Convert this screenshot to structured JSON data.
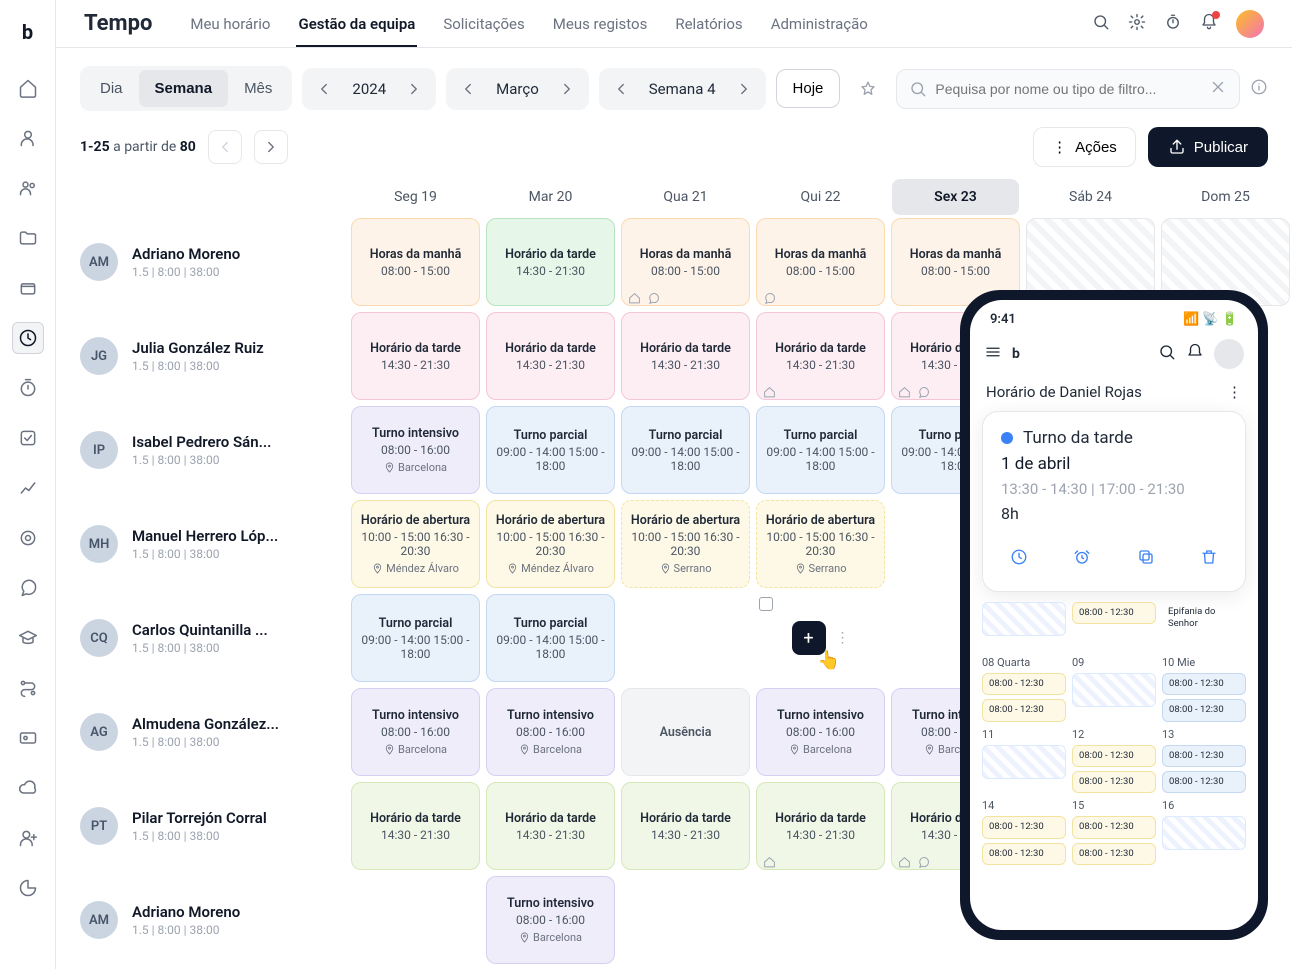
{
  "app_title": "Tempo",
  "tabs": [
    "Meu horário",
    "Gestão da equipa",
    "Solicitações",
    "Meus registos",
    "Relatórios",
    "Administração"
  ],
  "active_tab": 1,
  "view_seg": {
    "options": [
      "Dia",
      "Semana",
      "Mês"
    ],
    "selected": 1
  },
  "year": "2024",
  "month": "Março",
  "week": "Semana 4",
  "today_label": "Hoje",
  "search_placeholder": "Pequisa por nome ou tipo de filtro...",
  "pager": {
    "range": "1-25",
    "sep": "a partir de",
    "total": "80"
  },
  "actions_label": "Ações",
  "publish_label": "Publicar",
  "day_headers": [
    "Seg 19",
    "Mar 20",
    "Qua 21",
    "Qui 22",
    "Sex 23",
    "Sáb 24",
    "Dom 25"
  ],
  "highlight_day": 4,
  "employee_sub": "1.5 | 8:00 | 38:00",
  "employees": [
    {
      "name": "Adriano Moreno",
      "initials": "AM",
      "cells": [
        {
          "type": "orange",
          "title": "Horas da manhã",
          "time": "08:00 - 15:00"
        },
        {
          "type": "green",
          "title": "Horário da tarde",
          "time": "14:30 - 21:30"
        },
        {
          "type": "orange",
          "title": "Horas da manhã",
          "time": "08:00 - 15:00",
          "icons": [
            "home",
            "chat"
          ]
        },
        {
          "type": "orange",
          "title": "Horas da manhã",
          "time": "08:00 - 15:00",
          "icons": [
            "chat"
          ]
        },
        {
          "type": "orange",
          "title": "Horas da manhã",
          "time": "08:00 - 15:00"
        },
        {
          "type": "hatch"
        },
        {
          "type": "hatch"
        }
      ]
    },
    {
      "name": "Julia González Ruiz",
      "initials": "JG",
      "cells": [
        {
          "type": "pink",
          "title": "Horário da tarde",
          "time": "14:30 - 21:30"
        },
        {
          "type": "pink",
          "title": "Horário da tarde",
          "time": "14:30 - 21:30"
        },
        {
          "type": "pink",
          "title": "Horário da tarde",
          "time": "14:30 - 21:30"
        },
        {
          "type": "pink",
          "title": "Horário da tarde",
          "time": "14:30 - 21:30",
          "icons": [
            "home"
          ]
        },
        {
          "type": "pink",
          "title": "Horário da tarde",
          "time": "14:30 - 21:30",
          "icons": [
            "home",
            "chat"
          ]
        },
        {
          "type": "empty"
        },
        {
          "type": "empty"
        }
      ]
    },
    {
      "name": "Isabel Pedrero Sán...",
      "initials": "IP",
      "cells": [
        {
          "type": "purple",
          "title": "Turno intensivo",
          "time": "08:00 - 16:00",
          "loc": "Barcelona"
        },
        {
          "type": "blue",
          "title": "Turno parcial",
          "time": "09:00 - 14:00 15:00 - 18:00"
        },
        {
          "type": "blue",
          "title": "Turno parcial",
          "time": "09:00 - 14:00 15:00 - 18:00"
        },
        {
          "type": "blue",
          "title": "Turno parcial",
          "time": "09:00 - 14:00 15:00 - 18:00"
        },
        {
          "type": "blue",
          "title": "Turno parcial",
          "time": "09:00 - 14:00 15:00 - 18:00"
        },
        {
          "type": "empty"
        },
        {
          "type": "empty"
        }
      ]
    },
    {
      "name": "Manuel Herrero Lóp...",
      "initials": "MH",
      "cells": [
        {
          "type": "yellow",
          "title": "Horário de abertura",
          "time": "10:00 - 15:00 16:30 - 20:30",
          "loc": "Méndez Álvaro"
        },
        {
          "type": "yellow",
          "title": "Horário de abertura",
          "time": "10:00 - 15:00 16:30 - 20:30",
          "loc": "Méndez Álvaro"
        },
        {
          "type": "yellow",
          "dash": true,
          "title": "Horário de abertura",
          "time": "10:00 - 15:00 16:30 - 20:30",
          "loc": "Serrano"
        },
        {
          "type": "yellow",
          "dash": true,
          "title": "Horário de abertura",
          "time": "10:00 - 15:00 16:30 - 20:30",
          "loc": "Serrano"
        },
        {
          "type": "empty"
        },
        {
          "type": "empty"
        },
        {
          "type": "empty"
        }
      ]
    },
    {
      "name": "Carlos Quintanilla ...",
      "initials": "CQ",
      "cells": [
        {
          "type": "blue",
          "title": "Turno parcial",
          "time": "09:00 - 14:00 15:00 - 18:00"
        },
        {
          "type": "blue",
          "title": "Turno parcial",
          "time": "09:00 - 14:00 15:00 - 18:00"
        },
        {
          "type": "empty"
        },
        {
          "type": "hover"
        },
        {
          "type": "empty"
        },
        {
          "type": "empty"
        },
        {
          "type": "empty"
        }
      ]
    },
    {
      "name": "Almudena González...",
      "initials": "AG",
      "cells": [
        {
          "type": "purple",
          "title": "Turno intensivo",
          "time": "08:00 - 16:00",
          "loc": "Barcelona"
        },
        {
          "type": "purple",
          "title": "Turno intensivo",
          "time": "08:00 - 16:00",
          "loc": "Barcelona"
        },
        {
          "type": "grey",
          "title": "Ausência"
        },
        {
          "type": "purple",
          "title": "Turno intensivo",
          "time": "08:00 - 16:00",
          "loc": "Barcelona"
        },
        {
          "type": "purple",
          "title": "Turno intensivo",
          "time": "08:00 - 16:00",
          "loc": "Barcelona"
        },
        {
          "type": "empty"
        },
        {
          "type": "empty"
        }
      ]
    },
    {
      "name": "Pilar Torrejón Corral",
      "initials": "PT",
      "cells": [
        {
          "type": "lgreen",
          "title": "Horário da tarde",
          "time": "14:30 - 21:30"
        },
        {
          "type": "lgreen",
          "title": "Horário da tarde",
          "time": "14:30 - 21:30"
        },
        {
          "type": "lgreen",
          "title": "Horário da tarde",
          "time": "14:30 - 21:30"
        },
        {
          "type": "lgreen",
          "title": "Horário da tarde",
          "time": "14:30 - 21:30",
          "icons": [
            "home"
          ]
        },
        {
          "type": "lgreen",
          "title": "Horário da tarde",
          "time": "14:30 - 21:30",
          "icons": [
            "home",
            "chat"
          ]
        },
        {
          "type": "empty"
        },
        {
          "type": "empty"
        }
      ]
    },
    {
      "name": "Adriano Moreno",
      "initials": "AM",
      "cells": [
        {
          "type": "empty"
        },
        {
          "type": "purple",
          "title": "Turno intensivo",
          "time": "08:00 - 16:00",
          "loc": "Barcelona"
        },
        {
          "type": "empty"
        },
        {
          "type": "empty"
        },
        {
          "type": "empty"
        },
        {
          "type": "empty"
        },
        {
          "type": "empty"
        }
      ]
    }
  ],
  "phone": {
    "time": "9:41",
    "title": "Horário de Daniel Rojas",
    "card": {
      "shift_name": "Turno da tarde",
      "date": "1 de abril",
      "time": "13:30 - 14:30 | 17:00 - 21:30",
      "hours": "8h"
    },
    "cal_top": [
      {
        "label": "",
        "chips": [
          {
            "t": "hatch"
          }
        ]
      },
      {
        "label": "",
        "chips": [
          {
            "t": "yel",
            "text": "08:00 - 12:30"
          }
        ]
      },
      {
        "label": "",
        "chips": [
          {
            "t": "plain",
            "text": "Epifania do Senhor"
          }
        ]
      }
    ],
    "cal": [
      {
        "label": "08 Quarta",
        "chips": [
          {
            "t": "yel",
            "text": "08:00 - 12:30"
          },
          {
            "t": "yel",
            "text": "08:00 - 12:30"
          }
        ]
      },
      {
        "label": "09",
        "chips": [
          {
            "t": "hatch"
          }
        ]
      },
      {
        "label": "10 Mie",
        "chips": [
          {
            "t": "blu",
            "text": "08:00 - 12:30"
          },
          {
            "t": "blu",
            "text": "08:00 - 12:30"
          }
        ]
      },
      {
        "label": "11",
        "chips": [
          {
            "t": "hatch"
          }
        ]
      },
      {
        "label": "12",
        "chips": [
          {
            "t": "yel",
            "text": "08:00 - 12:30"
          },
          {
            "t": "yel",
            "text": "08:00 - 12:30"
          }
        ]
      },
      {
        "label": "13",
        "chips": [
          {
            "t": "blu",
            "text": "08:00 - 12:30"
          },
          {
            "t": "blu",
            "text": "08:00 - 12:30"
          }
        ]
      },
      {
        "label": "14",
        "chips": [
          {
            "t": "yel",
            "text": "08:00 - 12:30"
          },
          {
            "t": "yel",
            "text": "08:00 - 12:30"
          }
        ]
      },
      {
        "label": "15",
        "chips": [
          {
            "t": "yel",
            "text": "08:00 - 12:30"
          },
          {
            "t": "yel",
            "text": "08:00 - 12:30"
          }
        ]
      },
      {
        "label": "16",
        "chips": [
          {
            "t": "hatch"
          }
        ]
      }
    ]
  }
}
